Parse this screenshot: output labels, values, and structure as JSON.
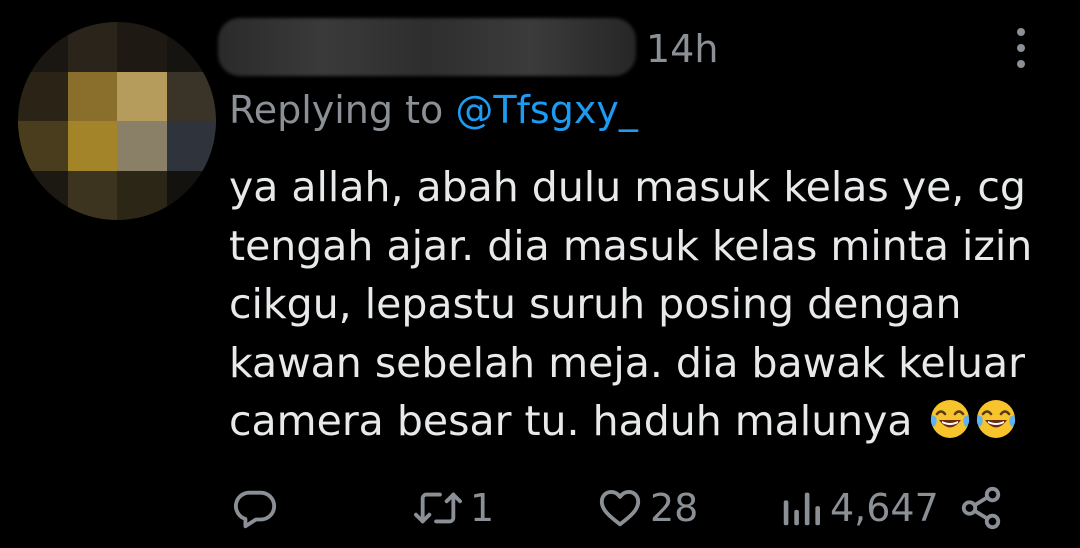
{
  "tweet": {
    "time": "14h",
    "reply_prefix": "Replying to",
    "reply_handle": "@Tfsgxy_",
    "body_lines": [
      "ya allah, abah dulu masuk kelas ye, cg",
      "tengah ajar. dia masuk kelas minta izin",
      "cikgu, lepastu suruh posing dengan",
      "kawan sebelah meja. dia bawak keluar",
      "camera besar tu. haduh malunya"
    ],
    "emojis": [
      "face-with-tears-of-joy-emoji",
      "face-with-tears-of-joy-emoji"
    ]
  },
  "actions": {
    "reply_icon": "reply-icon",
    "retweet_icon": "retweet-icon",
    "retweet_count": "1",
    "like_icon": "heart-icon",
    "like_count": "28",
    "views_icon": "views-icon",
    "views_count": "4,647",
    "share_icon": "share-icon"
  },
  "colors": {
    "background": "#000000",
    "text": "#e7e9ea",
    "muted": "#8b9096",
    "link": "#1d9bf0"
  }
}
